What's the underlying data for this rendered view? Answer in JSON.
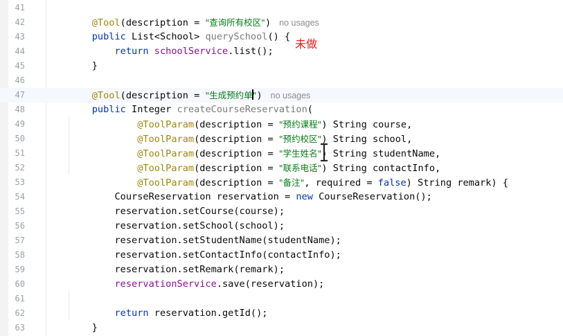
{
  "editor": {
    "annotation_note": "未做",
    "lines": [
      {
        "n": "41",
        "tokens": []
      },
      {
        "n": "42",
        "tokens": [
          {
            "t": "    "
          },
          {
            "t": "@Tool",
            "c": "ann"
          },
          {
            "t": "(description = "
          },
          {
            "t": "\"查询所有校区\"",
            "c": "str"
          },
          {
            "t": ")"
          },
          {
            "t": "no usages",
            "c": "hint"
          }
        ]
      },
      {
        "n": "43",
        "tokens": [
          {
            "t": "    "
          },
          {
            "t": "public ",
            "c": "kw"
          },
          {
            "t": "List<School> "
          },
          {
            "t": "querySchool",
            "c": "meth"
          },
          {
            "t": "() {"
          }
        ]
      },
      {
        "n": "44",
        "tokens": [
          {
            "t": "        "
          },
          {
            "t": "return ",
            "c": "kw"
          },
          {
            "t": "schoolService",
            "c": "fld"
          },
          {
            "t": ".list();"
          }
        ]
      },
      {
        "n": "45",
        "tokens": [
          {
            "t": "    }"
          }
        ]
      },
      {
        "n": "46",
        "tokens": []
      },
      {
        "n": "47",
        "current": true,
        "tokens": [
          {
            "t": "    "
          },
          {
            "t": "@Tool",
            "c": "ann"
          },
          {
            "t": "(description = "
          },
          {
            "t": "\"生成预约单",
            "c": "str"
          },
          {
            "t": "",
            "c": "caret"
          },
          {
            "t": "\"",
            "c": "str"
          },
          {
            "t": ")"
          },
          {
            "t": "no usages",
            "c": "hint"
          }
        ]
      },
      {
        "n": "48",
        "tokens": [
          {
            "t": "    "
          },
          {
            "t": "public ",
            "c": "kw"
          },
          {
            "t": "Integer "
          },
          {
            "t": "createCourseReservation",
            "c": "meth"
          },
          {
            "t": "("
          }
        ]
      },
      {
        "n": "49",
        "tokens": [
          {
            "t": "            "
          },
          {
            "t": "@ToolParam",
            "c": "ann"
          },
          {
            "t": "(description = "
          },
          {
            "t": "\"预约课程\"",
            "c": "str"
          },
          {
            "t": ") String course,"
          }
        ]
      },
      {
        "n": "50",
        "tokens": [
          {
            "t": "            "
          },
          {
            "t": "@ToolParam",
            "c": "ann"
          },
          {
            "t": "(description = "
          },
          {
            "t": "\"预约校区\"",
            "c": "str"
          },
          {
            "t": ") String school,"
          }
        ]
      },
      {
        "n": "51",
        "tokens": [
          {
            "t": "            "
          },
          {
            "t": "@ToolParam",
            "c": "ann"
          },
          {
            "t": "(description = "
          },
          {
            "t": "\"学生姓名\"",
            "c": "str"
          },
          {
            "t": ") String studentName,"
          }
        ]
      },
      {
        "n": "52",
        "tokens": [
          {
            "t": "            "
          },
          {
            "t": "@ToolParam",
            "c": "ann"
          },
          {
            "t": "(description = "
          },
          {
            "t": "\"联系电话\"",
            "c": "str"
          },
          {
            "t": ") String contactInfo,"
          }
        ]
      },
      {
        "n": "53",
        "tokens": [
          {
            "t": "            "
          },
          {
            "t": "@ToolParam",
            "c": "ann"
          },
          {
            "t": "(description = "
          },
          {
            "t": "\"备注\"",
            "c": "str"
          },
          {
            "t": ", required = "
          },
          {
            "t": "false",
            "c": "kw"
          },
          {
            "t": ") String remark) {"
          }
        ]
      },
      {
        "n": "54",
        "tokens": [
          {
            "t": "        CourseReservation reservation = "
          },
          {
            "t": "new ",
            "c": "kw"
          },
          {
            "t": "CourseReservation();"
          }
        ]
      },
      {
        "n": "55",
        "tokens": [
          {
            "t": "        reservation.setCourse(course);"
          }
        ]
      },
      {
        "n": "56",
        "tokens": [
          {
            "t": "        reservation.setSchool(school);"
          }
        ]
      },
      {
        "n": "57",
        "tokens": [
          {
            "t": "        reservation.setStudentName(studentName);"
          }
        ]
      },
      {
        "n": "58",
        "tokens": [
          {
            "t": "        reservation.setContactInfo(contactInfo);"
          }
        ]
      },
      {
        "n": "59",
        "tokens": [
          {
            "t": "        reservation.setRemark(remark);"
          }
        ]
      },
      {
        "n": "60",
        "tokens": [
          {
            "t": "        "
          },
          {
            "t": "reservationService",
            "c": "fld"
          },
          {
            "t": ".save(reservation);"
          }
        ]
      },
      {
        "n": "61",
        "tokens": []
      },
      {
        "n": "62",
        "tokens": [
          {
            "t": "        "
          },
          {
            "t": "return ",
            "c": "kw"
          },
          {
            "t": "reservation.getId();"
          }
        ]
      },
      {
        "n": "63",
        "tokens": [
          {
            "t": "    }"
          }
        ]
      }
    ],
    "colors": {
      "keyword": "#0033b3",
      "annotation": "#9e880d",
      "string": "#067d17",
      "field": "#871094",
      "note": "#e31b1b",
      "line_number": "#9aa0a6"
    },
    "icons": [
      "text-cursor-ibeam-icon"
    ]
  }
}
